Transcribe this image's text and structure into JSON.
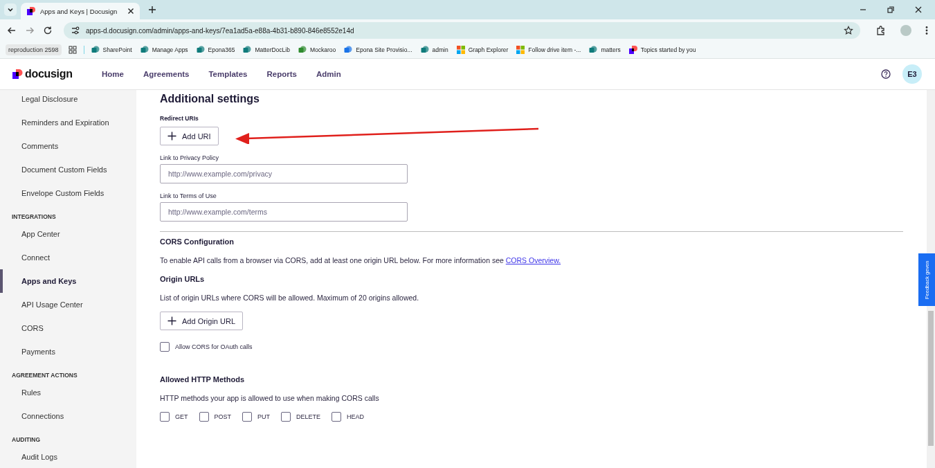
{
  "browser": {
    "tab": {
      "title": "Apps and Keys | Docusign"
    },
    "url": "apps-d.docusign.com/admin/apps-and-keys/7ea1ad5a-e88a-4b31-b890-846e8552e14d",
    "profile_chip": "reproduction 2598",
    "bookmarks": [
      {
        "label": "SharePoint"
      },
      {
        "label": "Manage Apps"
      },
      {
        "label": "Epona365"
      },
      {
        "label": "MatterDocLib"
      },
      {
        "label": "Mockaroo"
      },
      {
        "label": "Epona Site Provisio..."
      },
      {
        "label": "admin"
      },
      {
        "label": "Graph Explorer"
      },
      {
        "label": "Follow drive item -..."
      },
      {
        "label": "matters"
      },
      {
        "label": "Topics started by you"
      }
    ]
  },
  "header": {
    "logo": "docusign",
    "nav": [
      {
        "label": "Home"
      },
      {
        "label": "Agreements"
      },
      {
        "label": "Templates"
      },
      {
        "label": "Reports"
      },
      {
        "label": "Admin"
      }
    ],
    "avatar": "E3"
  },
  "sidebar": {
    "items": [
      {
        "kind": "link",
        "label": "Legal Disclosure",
        "selected": false
      },
      {
        "kind": "link",
        "label": "Reminders and Expiration",
        "selected": false
      },
      {
        "kind": "link",
        "label": "Comments",
        "selected": false
      },
      {
        "kind": "link",
        "label": "Document Custom Fields",
        "selected": false
      },
      {
        "kind": "link",
        "label": "Envelope Custom Fields",
        "selected": false
      },
      {
        "kind": "heading",
        "label": "INTEGRATIONS"
      },
      {
        "kind": "link",
        "label": "App Center",
        "selected": false
      },
      {
        "kind": "link",
        "label": "Connect",
        "selected": false
      },
      {
        "kind": "link",
        "label": "Apps and Keys",
        "selected": true
      },
      {
        "kind": "link",
        "label": "API Usage Center",
        "selected": false
      },
      {
        "kind": "link",
        "label": "CORS",
        "selected": false
      },
      {
        "kind": "link",
        "label": "Payments",
        "selected": false
      },
      {
        "kind": "heading",
        "label": "AGREEMENT ACTIONS"
      },
      {
        "kind": "link",
        "label": "Rules",
        "selected": false
      },
      {
        "kind": "link",
        "label": "Connections",
        "selected": false
      },
      {
        "kind": "heading",
        "label": "AUDITING"
      },
      {
        "kind": "link",
        "label": "Audit Logs",
        "selected": false
      }
    ]
  },
  "main": {
    "title": "Additional settings",
    "redirect_label": "Redirect URIs",
    "add_uri_button": "Add URI",
    "privacy_field": {
      "label": "Link to Privacy Policy",
      "placeholder": "http://www.example.com/privacy"
    },
    "terms_field": {
      "label": "Link to Terms of Use",
      "placeholder": "http://www.example.com/terms"
    },
    "cors": {
      "heading": "CORS Configuration",
      "text": "To enable API calls from a browser via CORS, add at least one origin URL below. For more information see",
      "link": "CORS Overview."
    },
    "origins": {
      "heading": "Origin URLs",
      "text": "List of origin URLs where CORS will be allowed. Maximum of 20 origins allowed.",
      "button": "Add Origin URL"
    },
    "oauth_checkbox": {
      "label": "Allow CORS for OAuth calls",
      "checked": false
    },
    "methods": {
      "heading": "Allowed HTTP Methods",
      "text": "HTTP methods your app is allowed to use when making CORS calls",
      "options": [
        {
          "label": "GET",
          "checked": false
        },
        {
          "label": "POST",
          "checked": false
        },
        {
          "label": "PUT",
          "checked": false
        },
        {
          "label": "DELETE",
          "checked": false
        },
        {
          "label": "HEAD",
          "checked": false
        }
      ]
    }
  },
  "feedback_tab": "Feedback geven"
}
